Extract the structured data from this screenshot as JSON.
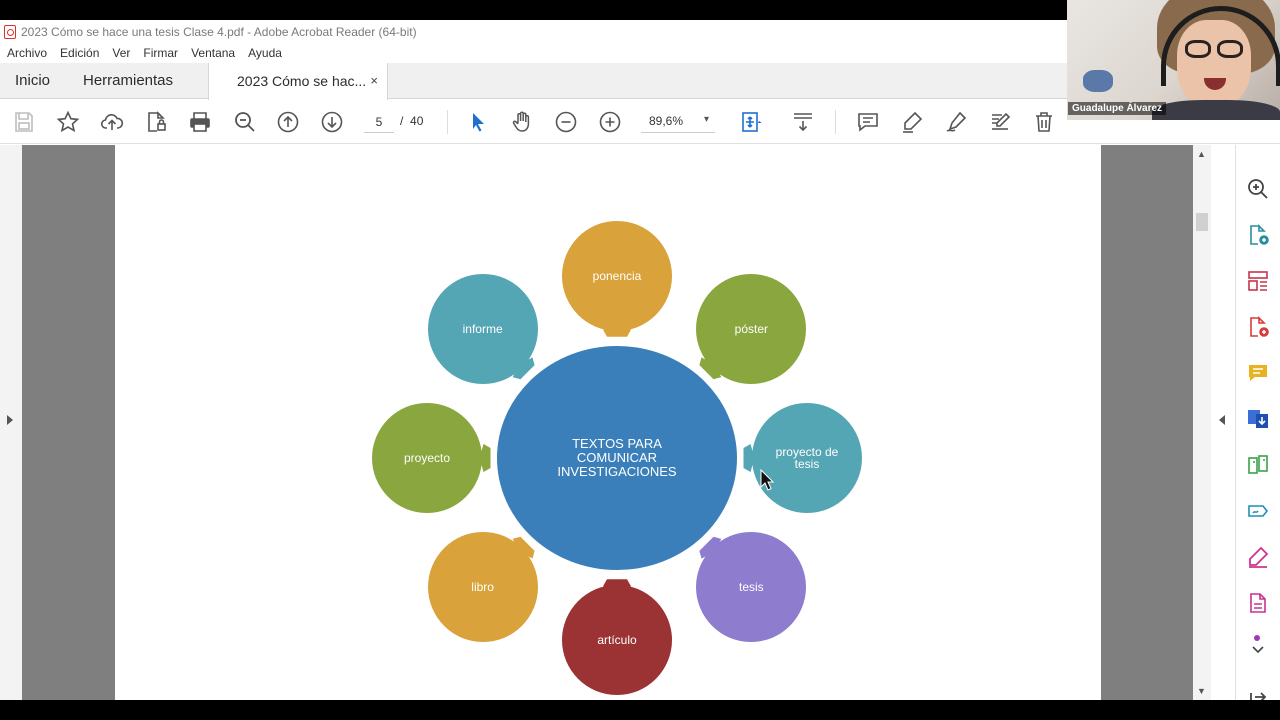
{
  "window": {
    "title": "2023 Cómo se hace una tesis Clase 4.pdf - Adobe Acrobat Reader (64-bit)"
  },
  "menu": [
    "Archivo",
    "Edición",
    "Ver",
    "Firmar",
    "Ventana",
    "Ayuda"
  ],
  "tabs": {
    "home": "Inicio",
    "tools": "Herramientas",
    "document": "2023 Cómo se hac...",
    "close_glyph": "×"
  },
  "toolbar": {
    "current_page": "5",
    "page_separator": "/",
    "total_pages": "40",
    "zoom": "89,6%",
    "zoom_caret": "▾"
  },
  "diagram": {
    "center": "TEXTOS PARA COMUNICAR INVESTIGACIONES",
    "nodes": [
      {
        "label": "ponencia",
        "color": "#d9a23a"
      },
      {
        "label": "póster",
        "color": "#8aa63e"
      },
      {
        "label": "proyecto de tesis",
        "color": "#55a6b4"
      },
      {
        "label": "tesis",
        "color": "#8e7cce"
      },
      {
        "label": "artículo",
        "color": "#9b3233"
      },
      {
        "label": "libro",
        "color": "#d9a23a"
      },
      {
        "label": "proyecto",
        "color": "#8aa63e"
      },
      {
        "label": "informe",
        "color": "#55a6b4"
      }
    ],
    "center_color": "#3a7fba"
  },
  "webcam": {
    "participant_name": "Guadalupe Álvarez"
  },
  "scroll": {
    "up_glyph": "▲",
    "down_glyph": "▼"
  }
}
